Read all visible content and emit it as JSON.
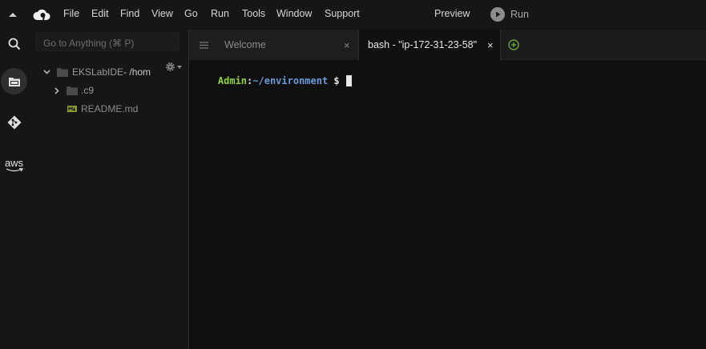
{
  "menubar": {
    "collapse_icon": "caret-up-icon",
    "logo_icon": "cloud9-logo-icon",
    "items": [
      "File",
      "Edit",
      "Find",
      "View",
      "Go",
      "Run",
      "Tools",
      "Window",
      "Support"
    ],
    "preview_label": "Preview",
    "run_label": "Run",
    "run_icon": "play-icon"
  },
  "rail": {
    "items": [
      {
        "name": "search",
        "icon": "search-icon"
      },
      {
        "name": "environment",
        "icon": "folder-icon",
        "active": true
      },
      {
        "name": "source-control",
        "icon": "git-icon"
      },
      {
        "name": "aws",
        "icon": "aws-logo-icon",
        "label": "aws"
      }
    ]
  },
  "filepanel": {
    "goto_placeholder": "Go to Anything (⌘ P)",
    "gear_icon": "gear-icon",
    "tree": [
      {
        "label": "EKSLabIDE",
        "suffix": " - /hom",
        "type": "folder",
        "expanded": true
      },
      {
        "label": ".c9",
        "type": "folder",
        "expanded": false
      },
      {
        "label": "README.md",
        "type": "markdown-file"
      }
    ]
  },
  "tabs": {
    "menu_icon": "hamburger-icon",
    "items": [
      {
        "label": "Welcome",
        "active": false
      },
      {
        "label": "bash - \"ip-172-31-23-58\"",
        "active": true
      }
    ],
    "close_glyph": "×",
    "add_icon": "plus-circle-icon"
  },
  "terminal": {
    "user": "Admin",
    "sep": ":",
    "path": "~/environment",
    "symbol": " $ "
  },
  "colors": {
    "prompt_user": "#8fd046",
    "prompt_path": "#6a9ad8",
    "add_tab": "#6ba33f"
  }
}
